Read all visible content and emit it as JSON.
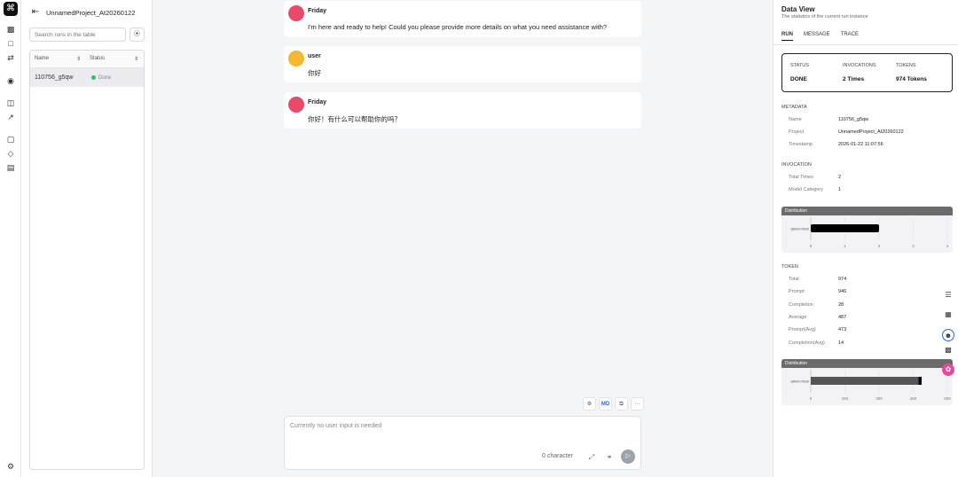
{
  "rail": {
    "logo": "⌘",
    "icons": [
      "chart-icon",
      "folder-icon",
      "prompt-icon",
      "robot-icon",
      "book-icon",
      "connection-icon",
      "chat-icon",
      "tag-icon",
      "gamepad-icon"
    ],
    "settings": "settings-icon"
  },
  "runs": {
    "project": "UnnamedProject_At20260122",
    "search_placeholder": "Search runs in the table",
    "columns": [
      "Name",
      "Status"
    ],
    "rows": [
      {
        "name": "110756_g5qw",
        "status": "Done"
      }
    ]
  },
  "chat": {
    "messages": [
      {
        "author": "Friday",
        "text": "I'm here and ready to help! Could you please provide more details on what you need assistance with?"
      },
      {
        "author": "user",
        "text": "你好"
      },
      {
        "author": "Friday",
        "text": "你好！有什么可以帮助你的吗？"
      }
    ],
    "toolbar": {
      "md": "MD",
      "more": "···"
    },
    "input_placeholder": "Currently no user input is needed",
    "char_count": "0 character"
  },
  "dataview": {
    "title": "Data View",
    "subtitle": "The statistics of the current run instance",
    "tabs": [
      "RUN",
      "MESSAGE",
      "TRACE"
    ],
    "stats": {
      "status_label": "STATUS",
      "status": "DONE",
      "invocations_label": "INVOCATIONS",
      "invocations": "2 Times",
      "tokens_label": "TOKENS",
      "tokens": "974 Tokens"
    },
    "metadata": {
      "label": "METADATA",
      "items": [
        {
          "k": "Name",
          "v": "110756_g5qw"
        },
        {
          "k": "Project",
          "v": "UnnamedProject_At20260122"
        },
        {
          "k": "Timestamp",
          "v": "2026-01-22 11:07:56"
        }
      ]
    },
    "invocation": {
      "label": "INVOCATION",
      "items": [
        {
          "k": "Total Times",
          "v": "2"
        },
        {
          "k": "Model Category",
          "v": "1"
        }
      ]
    },
    "token": {
      "label": "TOKEN",
      "items": [
        {
          "k": "Total",
          "v": "974"
        },
        {
          "k": "Prompt",
          "v": "946"
        },
        {
          "k": "Completion",
          "v": "28"
        },
        {
          "k": "Average",
          "v": "487"
        },
        {
          "k": "Prompt(Avg)",
          "v": "473"
        },
        {
          "k": "Completion(Avg)",
          "v": "14"
        }
      ]
    },
    "dist_label": "Distribution"
  },
  "chart_data": [
    {
      "type": "bar",
      "title": "Distribution",
      "orientation": "horizontal",
      "categories": [
        "qwen-max"
      ],
      "values": [
        2
      ],
      "xlim": [
        0,
        4
      ],
      "xticks": [
        0,
        1,
        2,
        3,
        4
      ]
    },
    {
      "type": "bar",
      "title": "Distribution",
      "orientation": "horizontal",
      "categories": [
        "qwen-max"
      ],
      "series": [
        {
          "values": [
            473
          ]
        },
        {
          "values": [
            14
          ]
        }
      ],
      "stacked": true,
      "xlim": [
        0,
        600
      ],
      "xticks": [
        0,
        150,
        300,
        450,
        600
      ]
    }
  ]
}
